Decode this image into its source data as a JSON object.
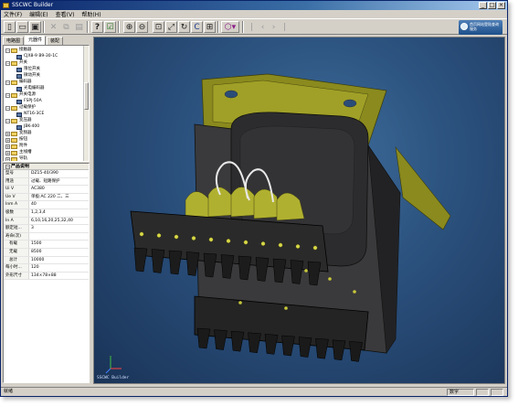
{
  "window": {
    "title": "SSCWC Builder",
    "controls": [
      "_",
      "□",
      "×"
    ]
  },
  "menu": [
    "文件(F)",
    "编辑(E)",
    "查看(V)",
    "帮助(H)"
  ],
  "toolbar": {
    "icons": [
      "new-icon",
      "open-icon",
      "save-icon",
      "cut-icon",
      "copy-icon",
      "paste-icon",
      "help-icon",
      "check-icon",
      "zoom-in-icon",
      "zoom-out-icon",
      "zoom-window-icon",
      "zoom-fit-icon",
      "pan-icon",
      "rotate-icon",
      "view-all-icon",
      "view-cube-icon",
      "first-icon",
      "prev-icon",
      "next-icon",
      "last-icon"
    ],
    "logo_text": "首页网站登陆查询服务"
  },
  "left_panel": {
    "tabs": [
      "电路图",
      "元器件",
      "装配"
    ],
    "active_tab": 1,
    "tree": [
      {
        "level": 0,
        "type": "folder",
        "label": "接触器",
        "expanded": true
      },
      {
        "level": 1,
        "type": "item",
        "label": "CJX8-9 B9-30-1C"
      },
      {
        "level": 0,
        "type": "folder",
        "label": "开关",
        "expanded": true
      },
      {
        "level": 1,
        "type": "item",
        "label": "限位开关"
      },
      {
        "level": 1,
        "type": "item",
        "label": "微动开关"
      },
      {
        "level": 0,
        "type": "folder",
        "label": "编码器",
        "expanded": true
      },
      {
        "level": 1,
        "type": "item",
        "label": "光电编码器"
      },
      {
        "level": 0,
        "type": "folder",
        "label": "开关电源",
        "expanded": true
      },
      {
        "level": 1,
        "type": "item",
        "label": "FSPJ-50A"
      },
      {
        "level": 0,
        "type": "folder",
        "label": "过载保护",
        "expanded": true
      },
      {
        "level": 1,
        "type": "item",
        "label": "NT16-3CE"
      },
      {
        "level": 0,
        "type": "folder",
        "label": "变压器",
        "expanded": true
      },
      {
        "level": 1,
        "type": "item",
        "label": "JBK-400"
      },
      {
        "level": 0,
        "type": "folder",
        "label": "变频器",
        "expanded": false
      },
      {
        "level": 0,
        "type": "folder",
        "label": "按钮",
        "expanded": false
      },
      {
        "level": 0,
        "type": "folder",
        "label": "附件",
        "expanded": false
      },
      {
        "level": 0,
        "type": "folder",
        "label": "主线槽",
        "expanded": false
      },
      {
        "level": 0,
        "type": "folder",
        "label": "导轨",
        "expanded": false
      }
    ],
    "properties": {
      "header": "产品说明",
      "rows": [
        {
          "key": "型号",
          "value": "DZ15-40/390",
          "sub": false
        },
        {
          "key": "用途",
          "value": "过载、短路保护",
          "sub": false
        },
        {
          "key": "Ui V",
          "value": "AC380",
          "sub": false
        },
        {
          "key": "Ue V",
          "value": "单极:AC 220  二、三",
          "sub": false
        },
        {
          "key": "Inm A",
          "value": "40",
          "sub": false
        },
        {
          "key": "极数",
          "value": "1,2,3,4",
          "sub": false
        },
        {
          "key": "In A",
          "value": "6,10,16,20,25,32,40",
          "sub": false
        },
        {
          "key": "额定短...",
          "value": "3",
          "sub": false
        },
        {
          "key": "寿命(次)",
          "value": "",
          "sub": false
        },
        {
          "key": "有载",
          "value": "1500",
          "sub": true
        },
        {
          "key": "无载",
          "value": "8500",
          "sub": true
        },
        {
          "key": "总计",
          "value": "10000",
          "sub": true
        },
        {
          "key": "每小时...",
          "value": "120",
          "sub": false
        },
        {
          "key": "外形尺寸",
          "value": "134×78×88",
          "sub": false
        }
      ]
    }
  },
  "viewport": {
    "label": "SSCWC Builder",
    "axes": [
      "x",
      "y",
      "z"
    ]
  },
  "status": {
    "left": "就绪",
    "right": "数字"
  }
}
